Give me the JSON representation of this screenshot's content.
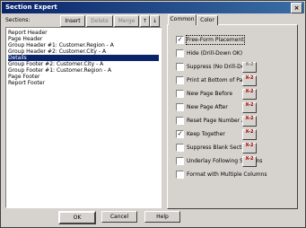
{
  "window": {
    "title": "Section Expert",
    "close_glyph": "×"
  },
  "sections_label": "Sections:",
  "toolbar": {
    "insert": "Insert",
    "delete": "Delete",
    "merge": "Merge",
    "up_glyph": "↑",
    "down_glyph": "↓"
  },
  "sections": [
    "Report Header",
    "Page Header",
    "Group Header #1: Customer.Region - A",
    "Group Header #2: Customer.City - A",
    "Details",
    "Group Footer #2: Customer.City - A",
    "Group Footer #1: Customer.Region - A",
    "Page Footer",
    "Report Footer"
  ],
  "selected_section": "Details",
  "tabs": [
    "Common",
    "Color"
  ],
  "options": [
    {
      "label": "Free-Form Placement",
      "checked": true
    },
    {
      "label": "Hide (Drill-Down OK)",
      "checked": false
    },
    {
      "label": "Suppress (No Drill-Down)",
      "checked": false
    },
    {
      "label": "Print at Bottom of Page",
      "checked": false
    },
    {
      "label": "New Page Before",
      "checked": false
    },
    {
      "label": "New Page After",
      "checked": false
    },
    {
      "label": "Reset Page Number After",
      "checked": false
    },
    {
      "label": "Keep Together",
      "checked": true
    },
    {
      "label": "Suppress Blank Section",
      "checked": false
    },
    {
      "label": "Underlay Following Sections",
      "checked": false
    },
    {
      "label": "Format with Multiple Columns",
      "checked": false
    }
  ],
  "formula_button": "X-2",
  "check_glyph": "✓",
  "buttons": {
    "ok": "OK",
    "cancel": "Cancel",
    "help": "Help"
  }
}
